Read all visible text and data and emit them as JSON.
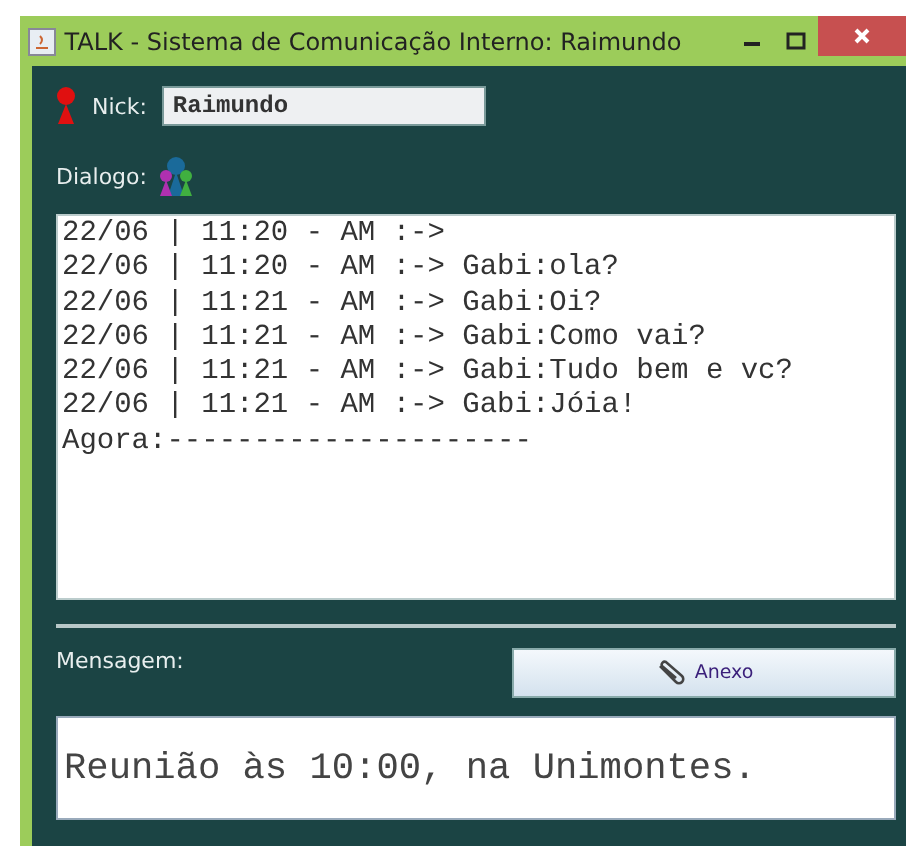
{
  "window": {
    "title": "TALK - Sistema de Comunicação Interno: Raimundo"
  },
  "nick": {
    "label": "Nick:",
    "value": "Raimundo"
  },
  "dialog": {
    "label": "Dialogo:",
    "lines": [
      "22/06 | 11:20 - AM :->",
      "22/06 | 11:20 - AM :-> Gabi:ola?",
      "22/06 | 11:21 - AM :-> Gabi:Oi?",
      "22/06 | 11:21 - AM :-> Gabi:Como vai?",
      "22/06 | 11:21 - AM :-> Gabi:Tudo bem e vc?",
      "22/06 | 11:21 - AM :-> Gabi:Jóia!",
      "Agora:---------------------"
    ]
  },
  "message": {
    "label": "Mensagem:",
    "attach_button": "Anexo",
    "value": "Reunião às 10:00, na Unimontes."
  }
}
